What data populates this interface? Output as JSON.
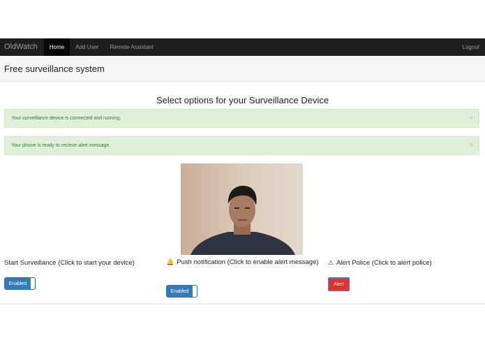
{
  "navbar": {
    "brand": "OldWatch",
    "items": [
      {
        "label": "Home",
        "active": true
      },
      {
        "label": "Add User",
        "active": false
      },
      {
        "label": "Remote Assistant",
        "active": false
      }
    ],
    "logout": "Logout"
  },
  "header": {
    "title": "Free surveillance system"
  },
  "main": {
    "heading": "Select options for your Surveillance Device",
    "alerts": [
      {
        "message": "Your surveillance device is connected and running.",
        "close": "×"
      },
      {
        "message": "Your phone is ready to recieve alert message.",
        "close": "×"
      }
    ],
    "camera": {
      "icon": "camera-feed-image"
    },
    "options": [
      {
        "label": "Start Surveillance (Click to start your device)",
        "control": "Enabled",
        "icon": ""
      },
      {
        "label": "Push notification (Click to enable alert message)",
        "control": "Enabled",
        "icon": "bell-icon",
        "icon_glyph": "🔔"
      },
      {
        "label": "Alert Police (Click to alert police)",
        "control": "Alert",
        "icon": "warning-icon",
        "icon_glyph": "⚠"
      }
    ]
  },
  "colors": {
    "navbar_bg": "#1e1e1e",
    "alert_bg": "#dff0d8",
    "alert_text": "#3c763d",
    "toggle_on": "#337ab7",
    "alert_button": "#d9342b"
  }
}
